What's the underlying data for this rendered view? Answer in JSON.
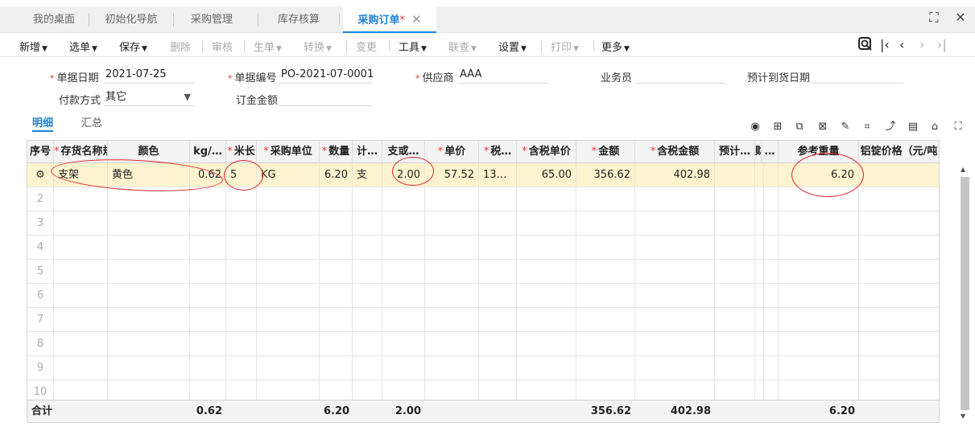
{
  "tabs": [
    {
      "label": "我的桌面"
    },
    {
      "label": "初始化导航"
    },
    {
      "label": "采购管理"
    },
    {
      "label": "库存核算"
    },
    {
      "label": "采购订单",
      "star": "*",
      "close": "✕"
    }
  ],
  "toolbar": {
    "items": [
      {
        "label": "新增",
        "enabled": true,
        "caret": true
      },
      {
        "label": "选单",
        "enabled": true,
        "caret": true
      },
      {
        "label": "保存",
        "enabled": true,
        "caret": true
      },
      {
        "label": "删除",
        "enabled": false,
        "caret": false
      },
      {
        "label": "审核",
        "enabled": false,
        "caret": false
      },
      {
        "label": "生单",
        "enabled": false,
        "caret": true
      },
      {
        "label": "转换",
        "enabled": false,
        "caret": true
      },
      {
        "label": "变更",
        "enabled": false,
        "caret": false
      },
      {
        "label": "工具",
        "enabled": true,
        "caret": true
      },
      {
        "label": "联查",
        "enabled": false,
        "caret": true
      },
      {
        "label": "设置",
        "enabled": true,
        "caret": true
      },
      {
        "label": "打印",
        "enabled": false,
        "caret": true
      },
      {
        "label": "更多",
        "enabled": true,
        "caret": true
      }
    ]
  },
  "form": {
    "date_label": "单据日期",
    "date_value": "2021-07-25",
    "number_label": "单据编号",
    "number_value": "PO-2021-07-0001",
    "supplier_label": "供应商",
    "supplier_value": "AAA",
    "salesman_label": "业务员",
    "salesman_value": "",
    "arrival_label": "预计到货日期",
    "arrival_value": "",
    "payment_label": "付款方式",
    "payment_value": "其它",
    "deposit_label": "订金金额",
    "deposit_value": ""
  },
  "subtabs": {
    "detail": "明细",
    "summary": "汇总"
  },
  "grid": {
    "headers": [
      "序号",
      "存货名称规",
      "颜色",
      "kg/…",
      "米长",
      "采购单位",
      "数量",
      "计…",
      "支或…",
      "单价",
      "税…",
      "含税单价",
      "金额",
      "含税金额",
      "预计…",
      "财",
      "…",
      "参考重量",
      "铝锭价格（元/吨"
    ],
    "required": [
      false,
      true,
      false,
      false,
      true,
      true,
      true,
      false,
      false,
      true,
      true,
      true,
      true,
      true,
      false,
      false,
      false,
      false,
      false
    ],
    "row1": {
      "name": "支架",
      "color": "黄色",
      "kg": "0.62",
      "length": "5",
      "unit": "KG",
      "qty": "6.20",
      "measure": "支",
      "pieces": "2.00",
      "price": "57.52",
      "tax": "13…",
      "taxprice": "65.00",
      "amount": "356.62",
      "taxamount": "402.98",
      "expected": "",
      "ref_weight": "6.20",
      "aluminum": ""
    },
    "empty_rows": [
      "2",
      "3",
      "4",
      "5",
      "6",
      "7",
      "8",
      "9",
      "10"
    ],
    "footer": {
      "label": "合计",
      "kg": "0.62",
      "qty": "6.20",
      "pieces": "2.00",
      "amount": "356.62",
      "taxamount": "402.98",
      "ref_weight": "6.20"
    }
  },
  "colors": {
    "accent": "#1f82d6",
    "required": "#e33333",
    "selected_row": "#fdf4cf",
    "annotation": "#e0242c"
  }
}
